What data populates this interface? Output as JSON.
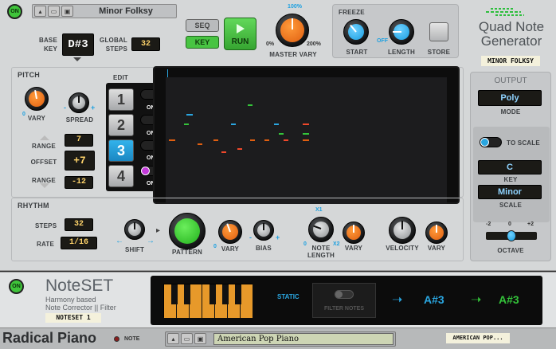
{
  "qng": {
    "power_label": "ON",
    "patch_name": "Minor Folksy",
    "base_key_label": "BASE\nKEY",
    "base_key": "D#3",
    "global_steps_label": "GLOBAL\nSTEPS",
    "global_steps": "32",
    "seq_label": "SEQ",
    "key_label": "KEY",
    "run_label": "RUN",
    "master_vary_label": "MASTER VARY",
    "master_vary_min": "0%",
    "master_vary_mid": "100%",
    "master_vary_max": "200%",
    "freeze_label": "FREEZE",
    "start_label": "START",
    "length_label": "LENGTH",
    "store_label": "STORE",
    "off_label": "OFF",
    "title_line1": "Quad Note",
    "title_line2": "Generator",
    "patch_tag": "MINOR FOLKSY",
    "pitch": {
      "title": "PITCH",
      "vary_label": "VARY",
      "spread_label": "SPREAD",
      "vary_zero": "0",
      "minus": "-",
      "plus": "+",
      "range_label": "RANGE",
      "range_top": "7",
      "offset_label": "OFFSET",
      "offset": "+7",
      "range_bottom": "-12"
    },
    "edit": {
      "title": "EDIT",
      "steps": [
        "1",
        "2",
        "3",
        "4"
      ],
      "on_label": "ON",
      "colors": [
        "#f0482b",
        "#34c43a",
        "#2aa6e0",
        "#c23ad9"
      ]
    },
    "rhythm": {
      "title": "RHYTHM",
      "steps_label": "STEPS",
      "steps": "32",
      "rate_label": "RATE",
      "rate": "1/16",
      "shift_label": "SHIFT",
      "pattern_label": "PATTERN",
      "vary_label": "VARY",
      "bias_label": "BIAS",
      "note_length_label": "NOTE\nLENGTH",
      "x1": "X1",
      "x2": "X2",
      "zero": "0",
      "vary2_label": "VARY",
      "velocity_label": "VELOCITY",
      "vary3_label": "VARY",
      "minus": "-",
      "plus": "+"
    },
    "output": {
      "title": "OUTPUT",
      "mode_value": "Poly",
      "mode_label": "MODE",
      "to_scale_label": "TO SCALE",
      "key_value": "C",
      "key_label": "KEY",
      "scale_value": "Minor",
      "scale_label": "SCALE",
      "octave_label": "OCTAVE",
      "octave_min": "-2",
      "octave_mid": "0",
      "octave_max": "+2"
    }
  },
  "noteset": {
    "power_label": "ON",
    "name": "NoteSET",
    "desc1": "Harmony based",
    "desc2": "Note Corrector || Filter",
    "tag": "NOTESET 1",
    "static_label": "STATIC",
    "filter_label": "FILTER NOTES",
    "in_note": "A#3",
    "out_note": "A#3"
  },
  "radical_piano": {
    "name": "Radical Piano",
    "note_label": "NOTE",
    "patch": "American Pop Piano",
    "tag": "AMERICAN POP..."
  }
}
